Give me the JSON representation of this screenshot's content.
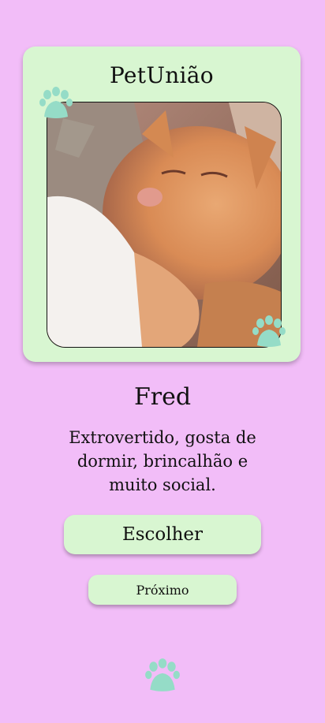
{
  "app": {
    "title": "PetUnião"
  },
  "pet": {
    "name": "Fred",
    "description": "Extrovertido, gosta de dormir, brincalhão e muito social.",
    "photo_alt": "Fred"
  },
  "actions": {
    "choose_label": "Escolher",
    "next_label": "Próximo"
  },
  "colors": {
    "background": "#f2bdf8",
    "card": "#d8f6d1",
    "paw": "#95dcc7"
  },
  "icons": {
    "paw": "paw-print-icon"
  }
}
